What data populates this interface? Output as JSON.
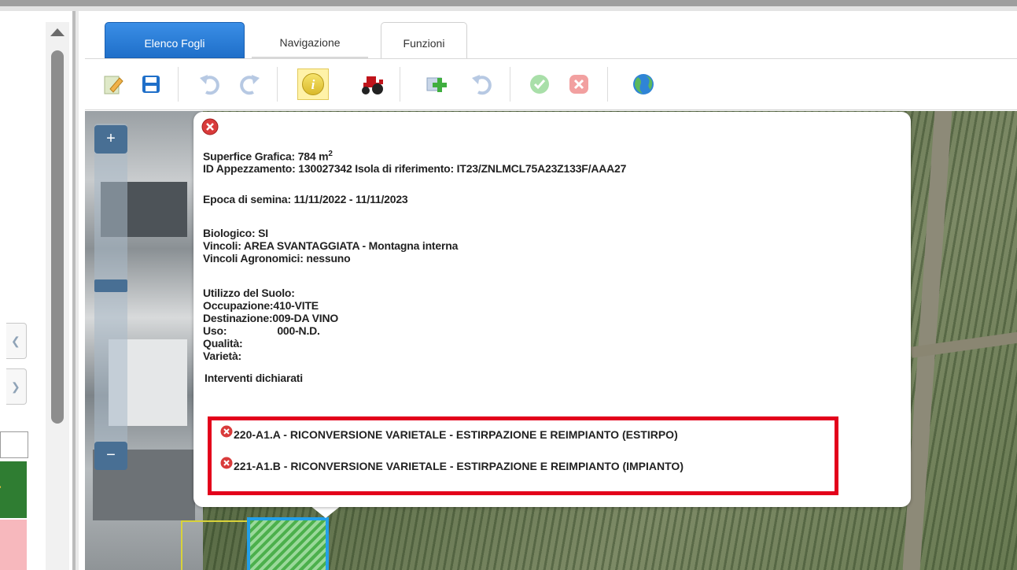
{
  "tabs": [
    {
      "label": "Elenco Fogli",
      "active": true
    },
    {
      "label": "Navigazione",
      "active": false
    },
    {
      "label": "Funzioni",
      "active": false
    }
  ],
  "toolbar": {
    "icons": [
      "edit-sheet-icon",
      "save-icon",
      "undo-icon",
      "redo-icon",
      "info-icon",
      "tractor-icon",
      "add-icon",
      "undo2-icon",
      "confirm-icon",
      "cancel-icon",
      "globe-icon"
    ]
  },
  "zoom": {
    "plus": "+",
    "minus": "−"
  },
  "popup": {
    "superficie_label": "Superfice Grafica: 784 m",
    "superficie_sup": "2",
    "id_appezzamento": "ID Appezzamento: 130027342  Isola di riferimento: IT23/ZNLMCL75A23Z133F/AAA27",
    "epoca": "Epoca di semina: 11/11/2022 - 11/11/2023",
    "biologico": "Biologico: SI",
    "vincoli": "Vincoli: AREA SVANTAGGIATA - Montagna interna",
    "vincoli_agronomici": "Vincoli Agronomici: nessuno",
    "utilizzo": "Utilizzo del Suolo:",
    "occupazione": "Occupazione:410-VITE",
    "destinazione": "Destinazione:009-DA VINO",
    "uso_label": "Uso:",
    "uso_value": "000-N.D.",
    "qualita": "Qualità:",
    "varieta": "Varietà:",
    "interventi_title": "Interventi dichiarati",
    "interventi": [
      "220-A1.A - RICONVERSIONE VARIETALE - ESTIRPAZIONE E REIMPIANTO (ESTIRPO)",
      "221-A1.B - RICONVERSIONE VARIETALE - ESTIRPAZIONE E REIMPIANTO (IMPIANTO)"
    ]
  },
  "colors": {
    "tab_active": "#1f6fc9",
    "highlight": "#e3001b",
    "parcel_border": "#22a0e8",
    "close_red": "#e04646"
  }
}
